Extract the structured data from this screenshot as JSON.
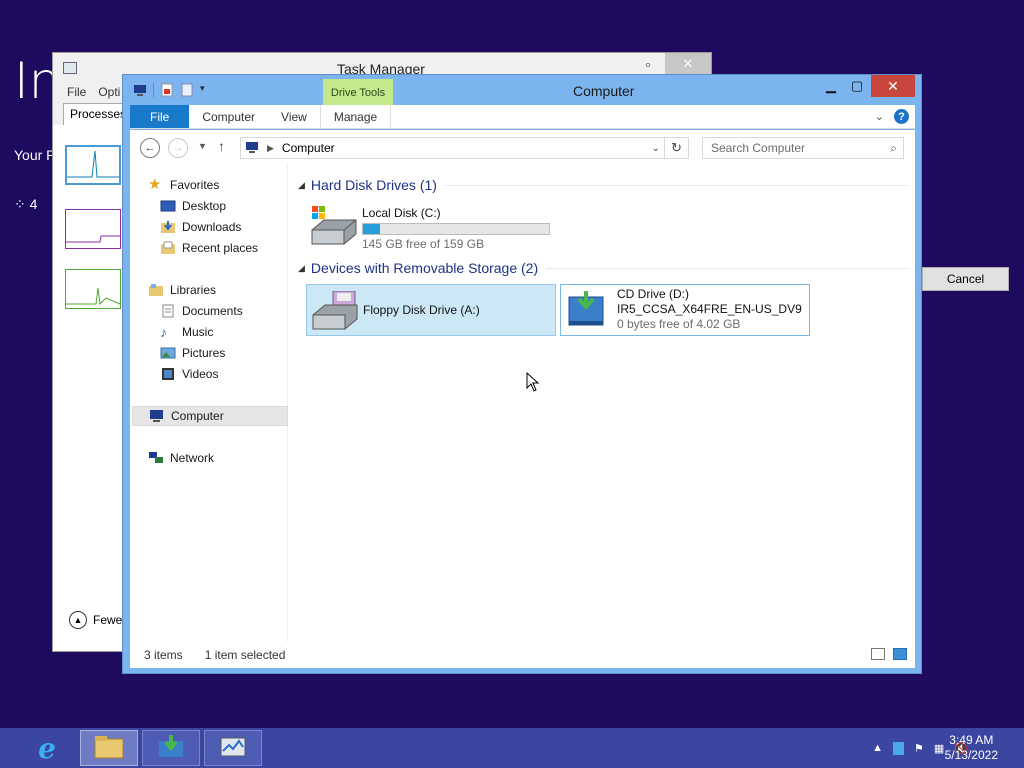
{
  "background": {
    "big_text": "In",
    "sub_text": "Your P",
    "spinner_text": "4",
    "cancel_label": "Cancel"
  },
  "task_manager": {
    "title": "Task Manager",
    "menu": [
      "File",
      "Opti"
    ],
    "tab": "Processes",
    "fewer_label": "Fewe"
  },
  "explorer": {
    "title": "Computer",
    "context_tab": "Drive Tools",
    "ribbon_tabs": {
      "file": "File",
      "computer": "Computer",
      "view": "View",
      "manage": "Manage"
    },
    "address": "Computer",
    "search_placeholder": "Search Computer",
    "nav": {
      "favorites": "Favorites",
      "desktop": "Desktop",
      "downloads": "Downloads",
      "recent": "Recent places",
      "libraries": "Libraries",
      "documents": "Documents",
      "music": "Music",
      "pictures": "Pictures",
      "videos": "Videos",
      "computer": "Computer",
      "network": "Network"
    },
    "groups": {
      "hdd": "Hard Disk Drives (1)",
      "removable": "Devices with Removable Storage (2)"
    },
    "drives": {
      "c": {
        "name": "Local Disk (C:)",
        "free": "145 GB free of 159 GB",
        "used_fraction": 0.09
      },
      "a": {
        "name": "Floppy Disk Drive (A:)"
      },
      "d": {
        "name": "CD Drive (D:)",
        "label": "IR5_CCSA_X64FRE_EN-US_DV9",
        "free": "0 bytes free of 4.02 GB"
      }
    },
    "status": {
      "items": "3 items",
      "selected": "1 item selected"
    }
  },
  "taskbar": {
    "time": "3:49 AM",
    "date": "5/13/2022"
  }
}
